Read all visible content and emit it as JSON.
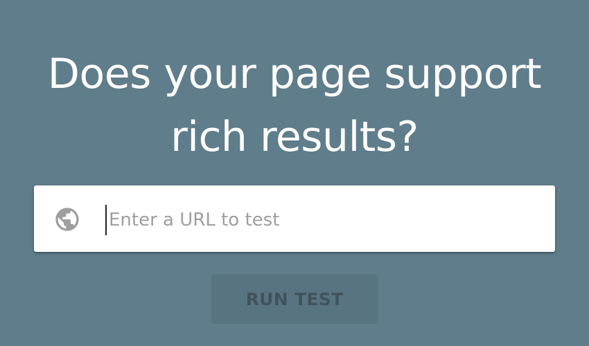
{
  "headline": {
    "line1": "Does your page support",
    "line2": "rich results?"
  },
  "url_field": {
    "icon": "globe-icon",
    "placeholder": "Enter a URL to test",
    "value": ""
  },
  "run_button": {
    "label": "RUN TEST",
    "state": "disabled"
  },
  "colors": {
    "background": "#607d8b",
    "headline_text": "#ffffff",
    "field_background": "#ffffff",
    "icon": "#9e9e9e",
    "placeholder": "#9e9e9e"
  }
}
